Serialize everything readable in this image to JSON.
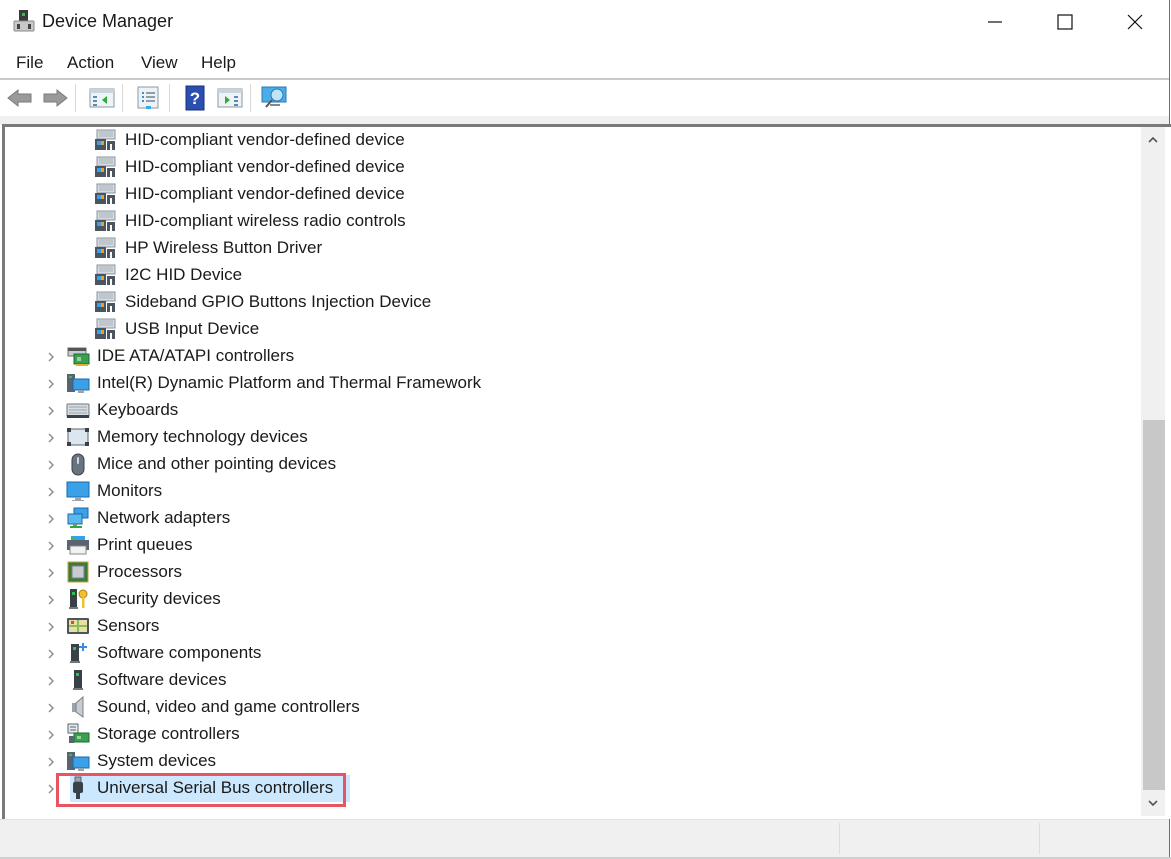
{
  "window": {
    "title": "Device Manager",
    "controls": {
      "minimize": "minimize",
      "maximize": "maximize",
      "close": "close"
    }
  },
  "menu": {
    "items": [
      {
        "label": "File"
      },
      {
        "label": "Action"
      },
      {
        "label": "View"
      },
      {
        "label": "Help"
      }
    ]
  },
  "toolbar": {
    "buttons": [
      {
        "name": "back",
        "icon": "arrow-left-icon",
        "tooltip": "Back"
      },
      {
        "name": "forward",
        "icon": "arrow-right-icon",
        "tooltip": "Forward"
      },
      {
        "name": "show-hide-console-tree",
        "icon": "console-tree-icon"
      },
      {
        "name": "properties",
        "icon": "properties-icon"
      },
      {
        "name": "help",
        "icon": "help-icon",
        "glyph": "?"
      },
      {
        "name": "show-hide-action-pane",
        "icon": "action-pane-icon"
      },
      {
        "name": "scan-hardware",
        "icon": "monitor-scan-icon"
      }
    ]
  },
  "tree": {
    "children": [
      {
        "label": "HID-compliant vendor-defined device",
        "icon": "hid-device-icon"
      },
      {
        "label": "HID-compliant vendor-defined device",
        "icon": "hid-device-icon"
      },
      {
        "label": "HID-compliant vendor-defined device",
        "icon": "hid-device-icon"
      },
      {
        "label": "HID-compliant wireless radio controls",
        "icon": "hid-device-icon"
      },
      {
        "label": "HP Wireless Button Driver",
        "icon": "hid-device-icon"
      },
      {
        "label": "I2C HID Device",
        "icon": "hid-device-icon"
      },
      {
        "label": "Sideband GPIO Buttons Injection Device",
        "icon": "hid-device-icon"
      },
      {
        "label": "USB Input Device",
        "icon": "hid-device-icon"
      }
    ],
    "categories": [
      {
        "label": "IDE ATA/ATAPI controllers",
        "icon": "ide-controller-icon",
        "expanded": false
      },
      {
        "label": "Intel(R) Dynamic Platform and Thermal Framework",
        "icon": "system-computer-icon",
        "expanded": false
      },
      {
        "label": "Keyboards",
        "icon": "keyboard-icon",
        "expanded": false
      },
      {
        "label": "Memory technology devices",
        "icon": "memory-device-icon",
        "expanded": false
      },
      {
        "label": "Mice and other pointing devices",
        "icon": "mouse-icon",
        "expanded": false
      },
      {
        "label": "Monitors",
        "icon": "monitor-icon",
        "expanded": false
      },
      {
        "label": "Network adapters",
        "icon": "network-adapter-icon",
        "expanded": false
      },
      {
        "label": "Print queues",
        "icon": "printer-icon",
        "expanded": false
      },
      {
        "label": "Processors",
        "icon": "processor-icon",
        "expanded": false
      },
      {
        "label": "Security devices",
        "icon": "security-device-icon",
        "expanded": false
      },
      {
        "label": "Sensors",
        "icon": "sensor-icon",
        "expanded": false
      },
      {
        "label": "Software components",
        "icon": "software-component-icon",
        "expanded": false
      },
      {
        "label": "Software devices",
        "icon": "software-device-icon",
        "expanded": false
      },
      {
        "label": "Sound, video and game controllers",
        "icon": "speaker-icon",
        "expanded": false
      },
      {
        "label": "Storage controllers",
        "icon": "storage-controller-icon",
        "expanded": false
      },
      {
        "label": "System devices",
        "icon": "system-computer-icon",
        "expanded": false
      },
      {
        "label": "Universal Serial Bus controllers",
        "icon": "usb-plug-icon",
        "expanded": false,
        "selected": true,
        "highlighted": true
      }
    ]
  },
  "colors": {
    "selection": "#cce8ff",
    "highlight_outline": "#e95462",
    "scroll_thumb": "#c8c8c8"
  },
  "statusbar": {
    "cells": [
      "",
      "",
      ""
    ]
  }
}
